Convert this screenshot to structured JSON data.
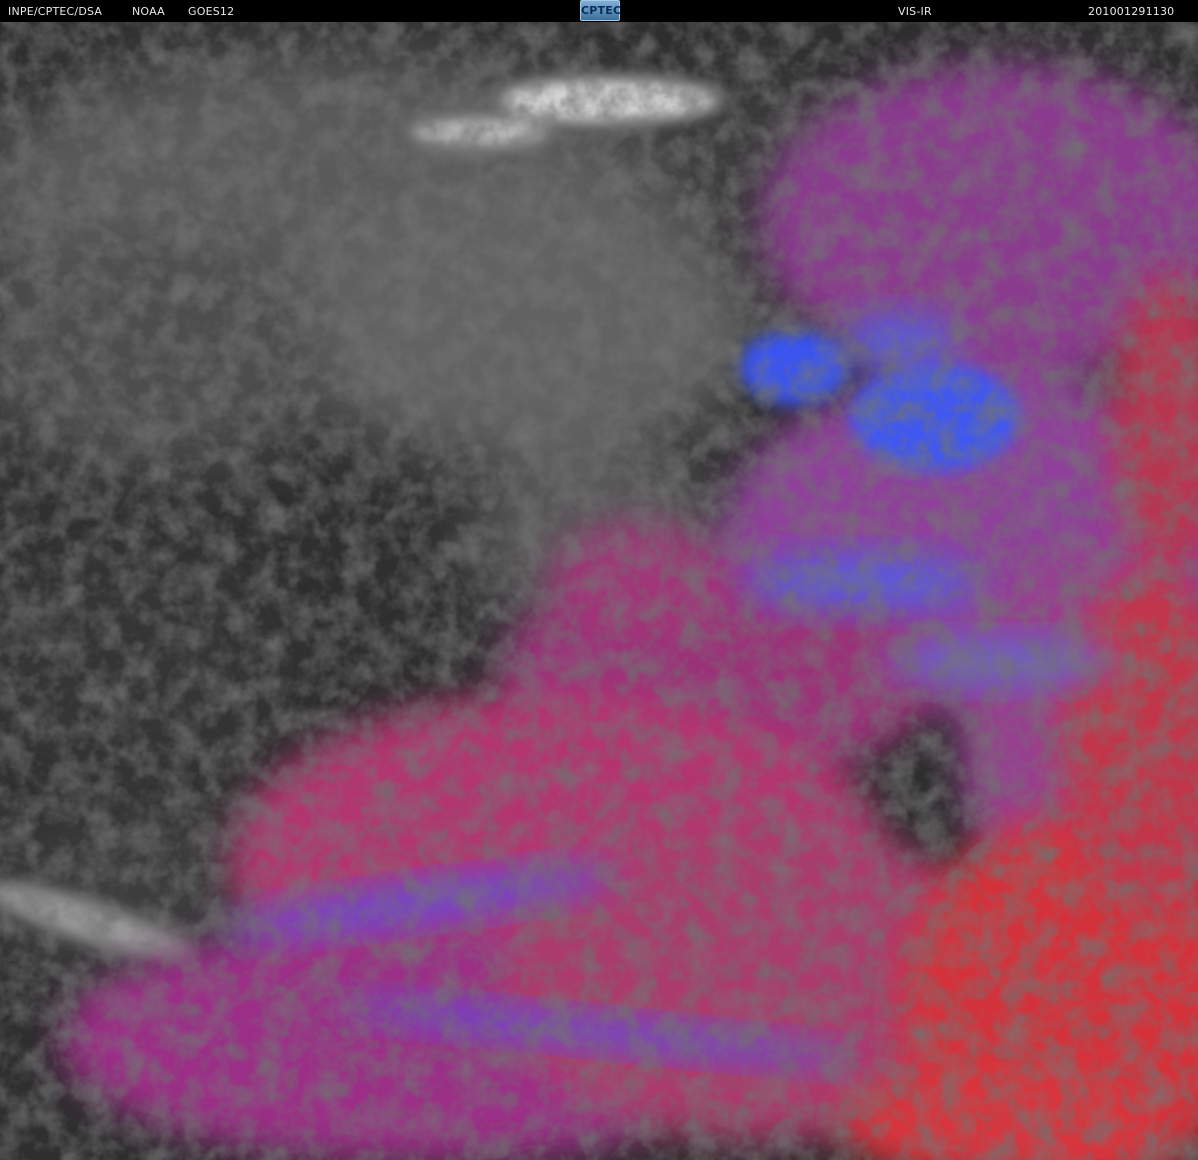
{
  "header": {
    "agency": "INPE/CPTEC/DSA",
    "provider": "NOAA",
    "satellite": "GOES12",
    "logo_text": "CPTEC",
    "product": "VIS-IR",
    "timestamp": "201001291130"
  },
  "colors": {
    "background_gray": "#2f2f2f",
    "cloud_gray": "#6e6e6e",
    "bright_cloud": "#cfcfcf",
    "magenta_cloud": "#b0306e",
    "violet_cloud": "#8a3aa0",
    "blue_cloud": "#3b55ee",
    "red_cloud": "#d8333a"
  }
}
